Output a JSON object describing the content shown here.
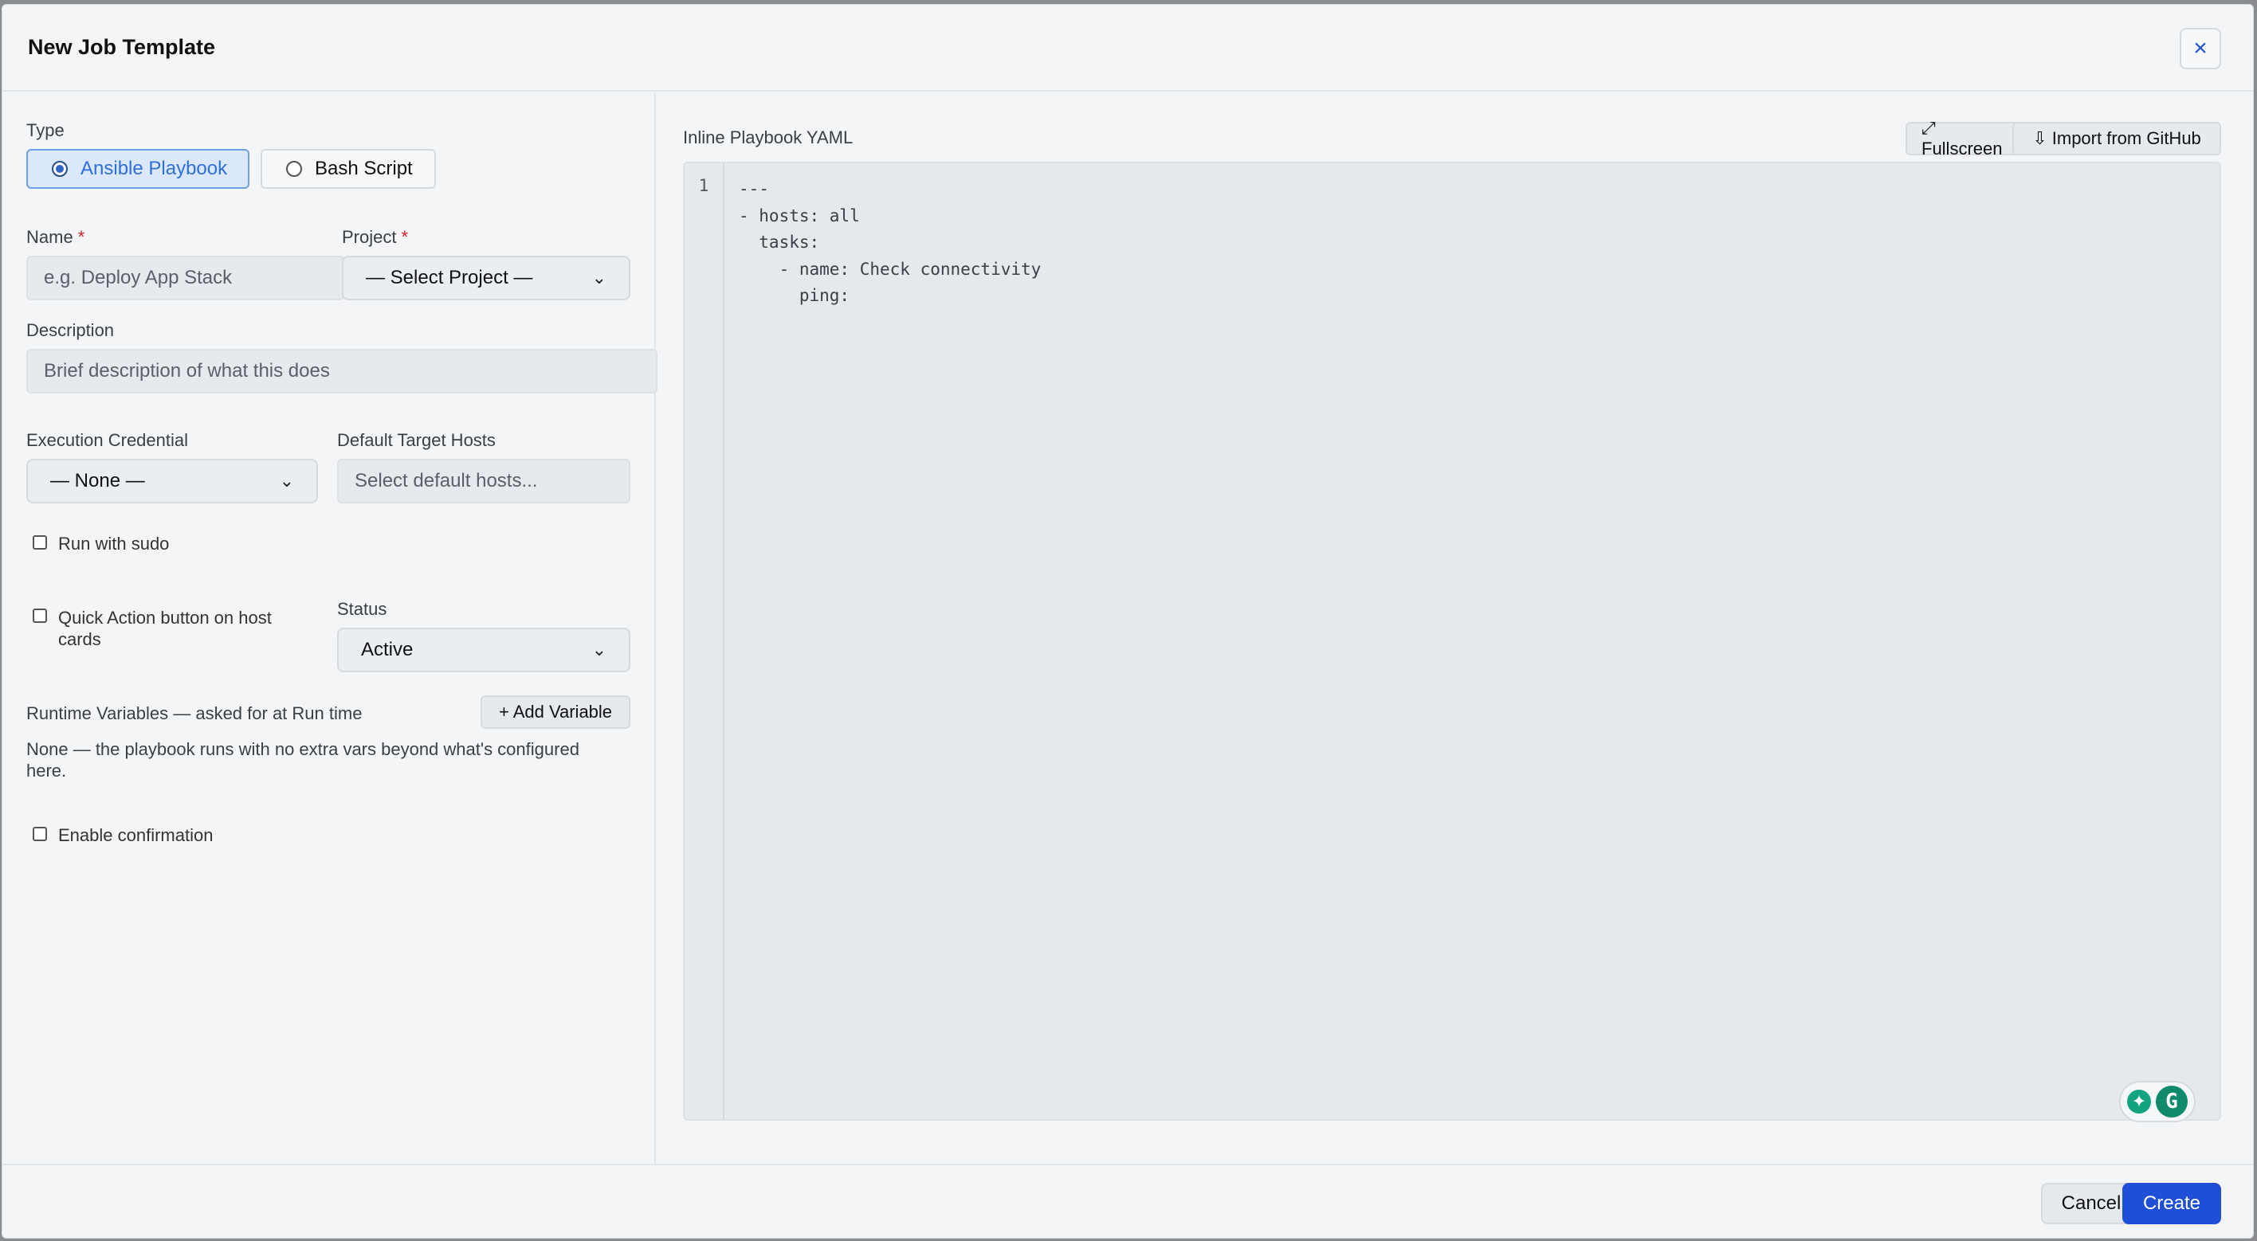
{
  "modal": {
    "title": "New Job Template",
    "close_icon": "×"
  },
  "form": {
    "type_label": "Type",
    "type_options": [
      {
        "label": "Ansible Playbook",
        "selected": true
      },
      {
        "label": "Bash Script",
        "selected": false
      }
    ],
    "name_label": "Name",
    "name_placeholder": "e.g. Deploy App Stack",
    "project_label": "Project",
    "project_value": "— Select Project —",
    "required_marker": "*",
    "description_label": "Description",
    "description_placeholder": "Brief description of what this does",
    "credential_label": "Execution Credential",
    "credential_value": "— None —",
    "hosts_label": "Default Target Hosts",
    "hosts_placeholder": "Select default hosts...",
    "sudo_label": "Run with sudo",
    "quick_action_label": "Quick Action button on host cards",
    "status_label": "Status",
    "status_value": "Active",
    "runtime_vars_label": "Runtime Variables — asked for at Run time",
    "add_variable_label": "+ Add Variable",
    "runtime_vars_empty": "None — the playbook runs with no extra vars beyond what's configured here.",
    "confirmation_label": "Enable confirmation"
  },
  "editor": {
    "label": "Inline Playbook YAML",
    "fullscreen_label": "⤢ Fullscreen",
    "import_label": "⇩ Import from GitHub",
    "line_numbers": "1",
    "code": "---\n- hosts: all\n  tasks:\n    - name: Check connectivity\n      ping:"
  },
  "footer": {
    "cancel_label": "Cancel",
    "create_label": "Create"
  },
  "colors": {
    "primary": "#1f4fd6",
    "selected_bg": "#dbe8fb",
    "grammarly": "#0f8a6a"
  },
  "icons": [
    "close-icon",
    "chevron-down-icon",
    "fullscreen-icon",
    "download-icon",
    "grammarly-icon"
  ]
}
